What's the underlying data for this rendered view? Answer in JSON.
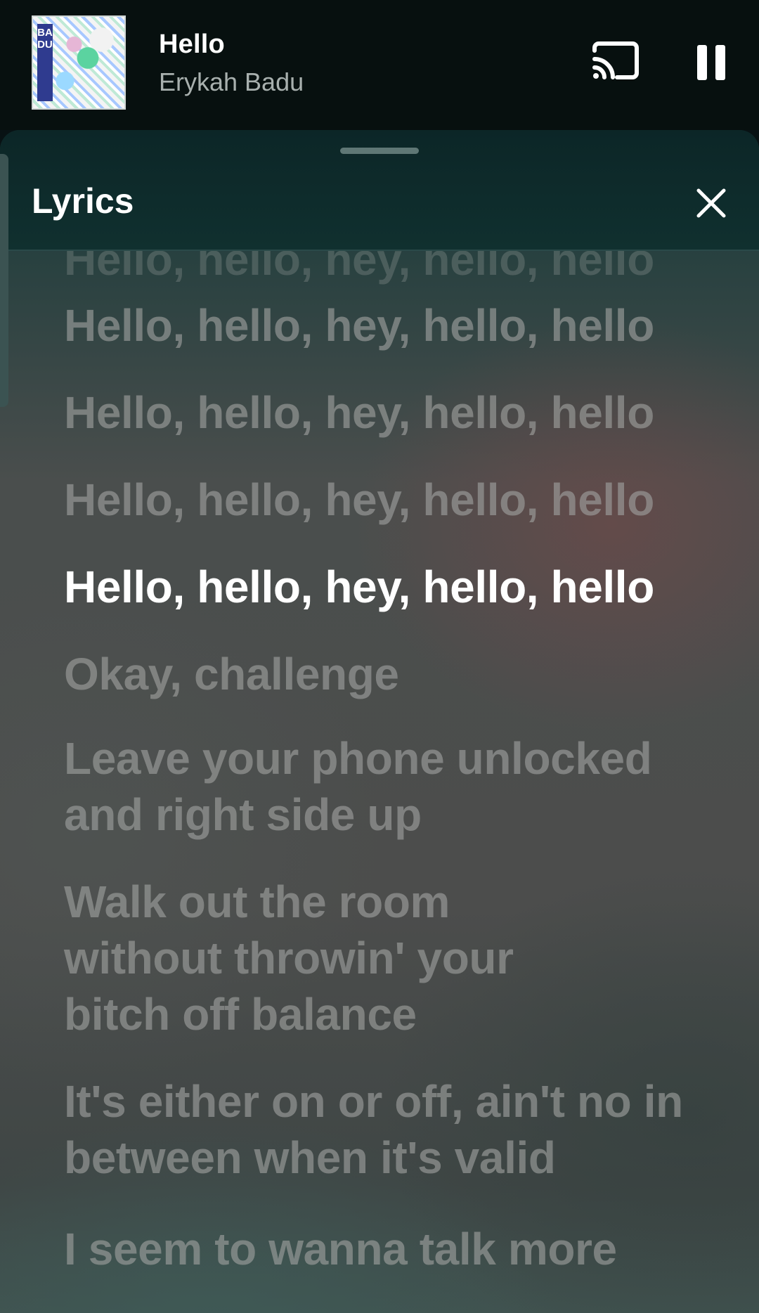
{
  "mini_player": {
    "album_art": {
      "icon": "album-cover",
      "text": "BADU",
      "colors": [
        "#2f3b8f",
        "#5bd3a0",
        "#9bd9ff",
        "#f2f2f2"
      ]
    },
    "title": "Hello",
    "artist": "Erykah Badu",
    "cast_icon": "cast-icon",
    "pause_icon": "pause-icon"
  },
  "lyrics_panel": {
    "title": "Lyrics",
    "close_icon": "close-icon",
    "handle_icon": "drag-handle",
    "lines": [
      "Hello, hello, hey, hello, hello",
      "Hello, hello, hey, hello, hello",
      "Hello, hello, hey, hello, hello",
      "Hello, hello, hey, hello, hello",
      "Hello, hello, hey, hello, hello",
      "Okay, challenge",
      "Leave your phone unlocked and right side up",
      "Walk out the room without throwin' your bitch off balance",
      "It's either on or off, ain't no in between when it's valid",
      "I seem to wanna talk more"
    ],
    "active_line_index": 4
  },
  "colors": {
    "header_background": "#07100f",
    "active_lyric": "#ffffff",
    "inactive_lyric": "#a0a2a0",
    "artist_text": "#a8b0ae"
  }
}
